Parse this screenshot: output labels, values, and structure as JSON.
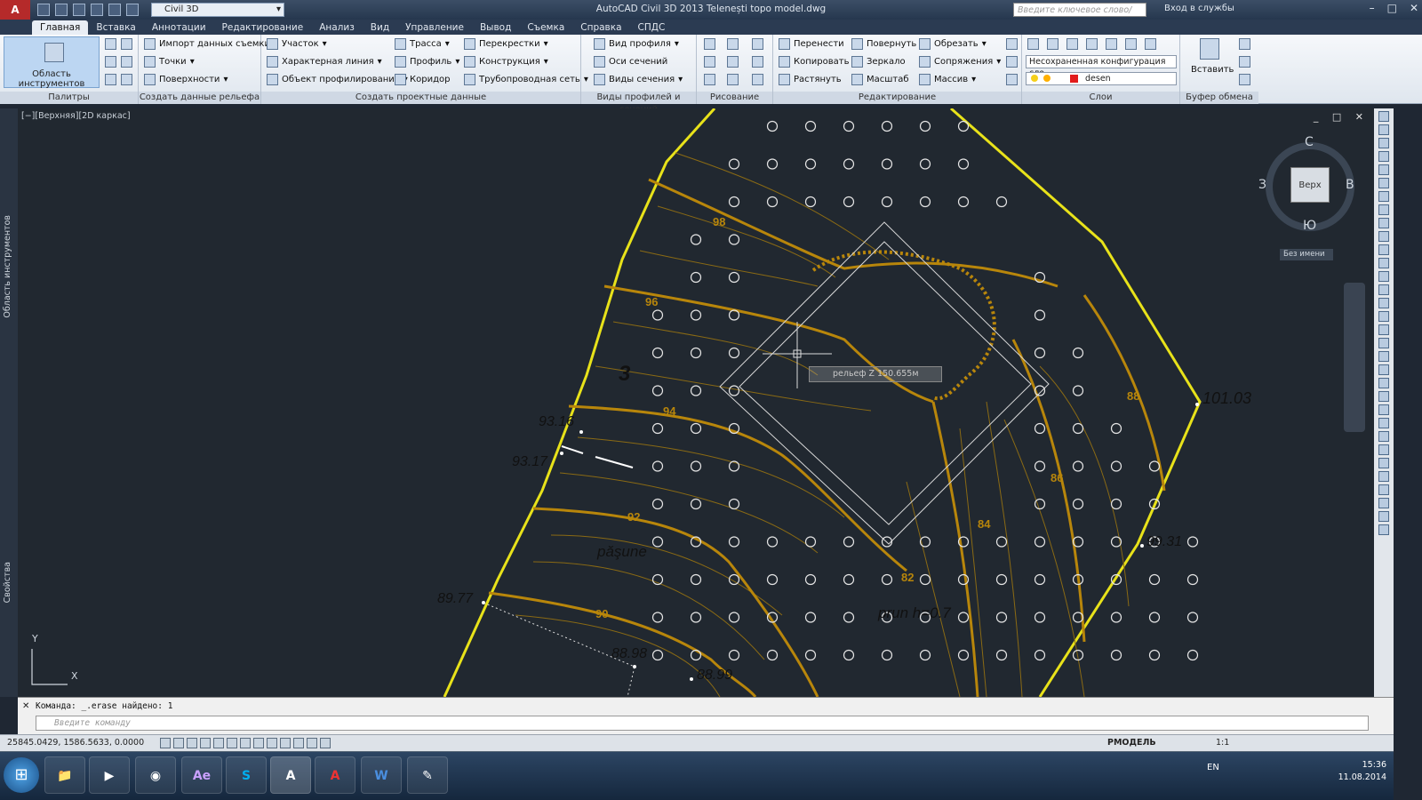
{
  "titlebar": {
    "app_logo": "A",
    "workspace": "Civil 3D",
    "title": "AutoCAD Civil 3D 2013   Telenești topo model.dwg",
    "search_placeholder": "Введите ключевое слово/фразу",
    "signin": "Вход в службы"
  },
  "tabs": [
    "Главная",
    "Вставка",
    "Аннотации",
    "Редактирование",
    "Анализ",
    "Вид",
    "Управление",
    "Вывод",
    "Съемка",
    "Справка",
    "СПДС"
  ],
  "ribbon": {
    "palettes_big": "Область инструментов",
    "panel_titles": {
      "palettes": "Палитры",
      "ground": "Создать данные рельефа",
      "design": "Создать проектные данные",
      "profiles": "Виды профилей и сечений",
      "draw": "Рисование",
      "modify": "Редактирование",
      "layers": "Слои",
      "clipboard": "Буфер обмена"
    },
    "ground": [
      "Импорт данных съемки",
      "Точки",
      "Поверхности"
    ],
    "design_a": [
      "Участок",
      "Характерная линия",
      "Объект профилирования"
    ],
    "design_b": [
      "Трасса",
      "Профиль",
      "Коридор"
    ],
    "design_c": [
      "Перекрестки",
      "Конструкция",
      "Трубопроводная сеть"
    ],
    "profiles": [
      "Вид профиля",
      "Оси сечений",
      "Виды сечения"
    ],
    "modify_a": [
      "Перенести",
      "Копировать",
      "Растянуть"
    ],
    "modify_b": [
      "Повернуть",
      "Зеркало",
      "Масштаб"
    ],
    "modify_c": [
      "Обрезать",
      "Сопряжения",
      "Массив"
    ],
    "layer_state": "Несохраненная конфигурация сло",
    "layer_current": "desen",
    "paste": "Вставить"
  },
  "viewport": {
    "label": "[−][Верхняя][2D каркас]",
    "viewcube": {
      "top": "Верх",
      "n": "С",
      "s": "Ю",
      "w": "З",
      "e": "В"
    },
    "ucs_name": "Без имени",
    "tooltip": "рельеф  Z   150.655м",
    "axis_x": "X",
    "axis_y": "Y"
  },
  "drawing": {
    "labels": [
      "3",
      "93.16",
      "93.17",
      "101.03",
      "99.31",
      "89.77",
      "88.98",
      "88.99",
      "păşune",
      "prun h=0.7"
    ],
    "contours": [
      "98",
      "96",
      "94",
      "92",
      "90",
      "88",
      "86",
      "84",
      "82"
    ]
  },
  "sidebar": {
    "tools": "Область инструментов",
    "props": "Свойства"
  },
  "command": {
    "history": "Команда: _.erase найдено: 1",
    "placeholder": "Введите команду"
  },
  "status": {
    "coords": "25845.0429, 1586.5633, 0.0000",
    "model": "РМОДЕЛЬ",
    "scale": "1:1"
  },
  "taskbar": {
    "apps": [
      "📁",
      "▶",
      "◉",
      "Ae",
      "S",
      "A",
      "A",
      "W",
      "✎"
    ],
    "lang": "EN",
    "time": "15:36",
    "date": "11.08.2014"
  },
  "colors": {
    "contour": "#b8860b",
    "boundary": "#e8e21a",
    "background": "#212830"
  }
}
